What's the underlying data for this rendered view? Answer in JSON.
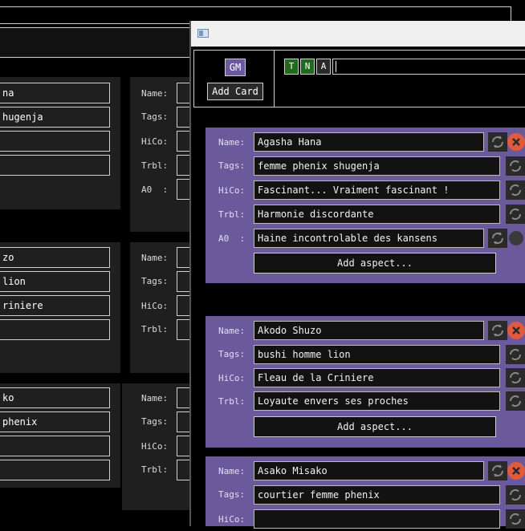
{
  "background_window": {
    "panels": [
      {
        "fields": [
          "na",
          "hugenja",
          "",
          ""
        ]
      },
      {
        "fields": [
          "zo",
          "lion",
          "riniere",
          ""
        ]
      },
      {
        "fields": [
          "ko",
          "phenix",
          "",
          ""
        ]
      }
    ],
    "right_panels": [
      {
        "labels": [
          "Name:",
          "Tags:",
          "HiCo:",
          "Trbl:",
          "A0  :"
        ]
      },
      {
        "labels": [
          "Name:",
          "Tags:",
          "HiCo:",
          "Trbl:"
        ]
      },
      {
        "labels": [
          "Name:",
          "Tags:",
          "HiCo:",
          "Trbl:"
        ]
      }
    ]
  },
  "toolbar": {
    "gm_label": "GM",
    "add_card_label": "Add Card",
    "chips": [
      "T",
      "N",
      "A"
    ],
    "input_value": ""
  },
  "cards": [
    {
      "name_label": "Name:",
      "name": "Agasha Hana",
      "tags_label": "Tags:",
      "tags": "femme phenix shugenja",
      "hico_label": "HiCo:",
      "hico": "Fascinant... Vraiment fascinant !",
      "trbl_label": "Trbl:",
      "trbl": "Harmonie discordante",
      "aspect_label": "A0  :",
      "aspect": "Haine incontrolable des kansens",
      "add_aspect": "Add aspect..."
    },
    {
      "name_label": "Name:",
      "name": "Akodo Shuzo",
      "tags_label": "Tags:",
      "tags": "bushi homme lion",
      "hico_label": "HiCo:",
      "hico": "Fleau de la Criniere",
      "trbl_label": "Trbl:",
      "trbl": "Loyaute envers ses proches",
      "add_aspect": "Add aspect..."
    },
    {
      "name_label": "Name:",
      "name": "Asako Misako",
      "tags_label": "Tags:",
      "tags": "courtier femme phenix",
      "hico_label": "HiCo:",
      "hico": ""
    }
  ],
  "colors": {
    "card_bg": "#6a5a9c",
    "gm_bg": "#6a5a9c",
    "chip_green": "#1e6b1e",
    "close_red": "#e25a3e"
  }
}
